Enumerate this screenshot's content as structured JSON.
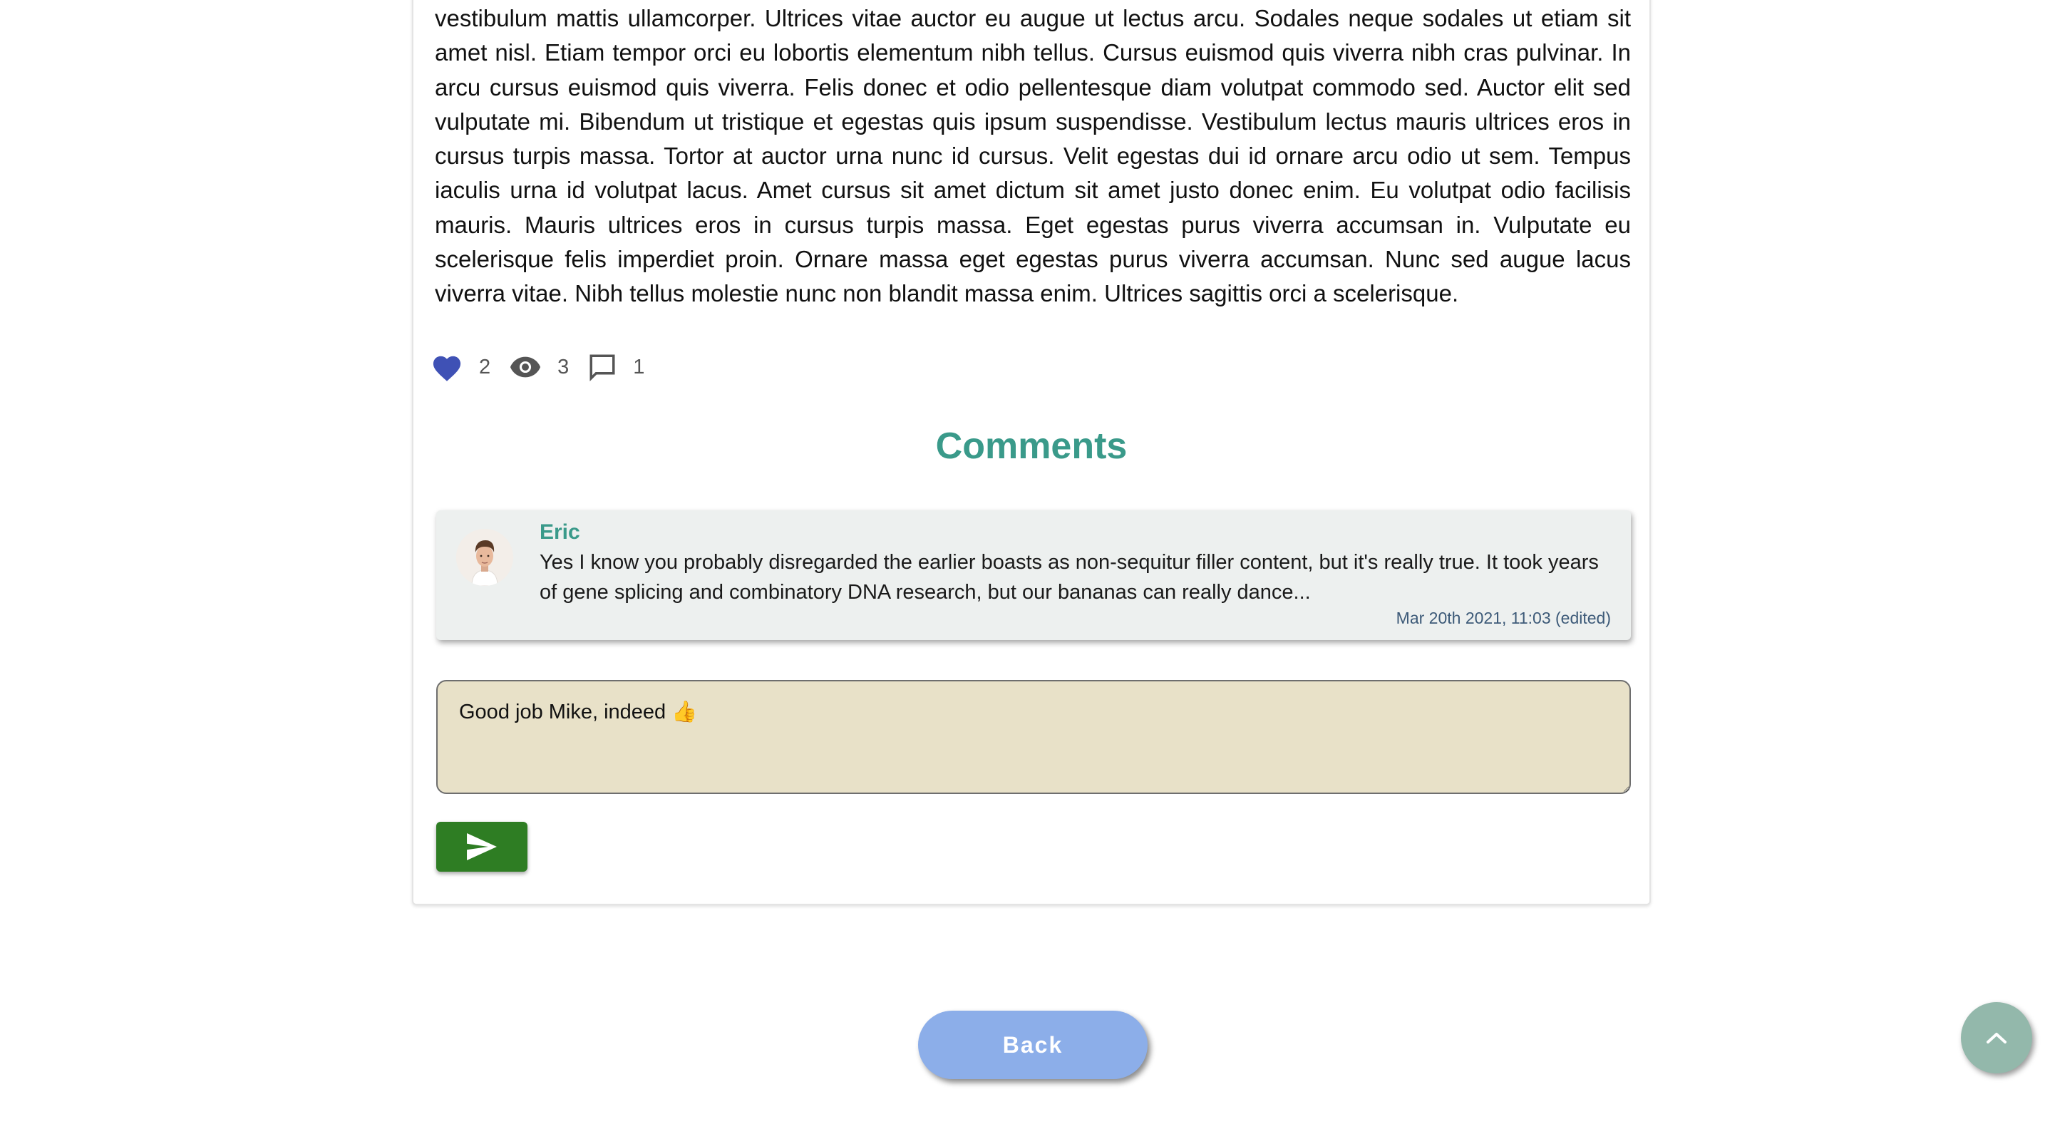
{
  "article": {
    "body": "vestibulum mattis ullamcorper. Ultrices vitae auctor eu augue ut lectus arcu. Sodales neque sodales ut etiam sit amet nisl. Etiam tempor orci eu lobortis elementum nibh tellus. Cursus euismod quis viverra nibh cras pulvinar. In arcu cursus euismod quis viverra. Felis donec et odio pellentesque diam volutpat commodo sed. Auctor elit sed vulputate mi. Bibendum ut tristique et egestas quis ipsum suspendisse. Vestibulum lectus mauris ultrices eros in cursus turpis massa. Tortor at auctor urna nunc id cursus. Velit egestas dui id ornare arcu odio ut sem. Tempus iaculis urna id volutpat lacus. Amet cursus sit amet dictum sit amet justo donec enim. Eu volutpat odio facilisis mauris. Mauris ultrices eros in cursus turpis massa. Eget egestas purus viverra accumsan in. Vulputate eu scelerisque felis imperdiet proin. Ornare massa eget egestas purus viverra accumsan. Nunc sed augue lacus viverra vitae. Nibh tellus molestie nunc non blandit massa enim. Ultrices sagittis orci a scelerisque."
  },
  "stats": {
    "likes": "2",
    "views": "3",
    "comments": "1",
    "icons": [
      "heart-icon",
      "eye-icon",
      "comment-icon"
    ]
  },
  "comments_section": {
    "title": "Comments",
    "items": [
      {
        "author": "Eric",
        "text": "Yes I know you probably disregarded the earlier boasts as non-sequitur filler content, but it's really true. It took years of gene splicing and combinatory DNA research, but our bananas can really dance...",
        "date": "Mar 20th 2021, 11:03 (edited)"
      }
    ],
    "input_value": "Good job Mike, indeed 👍",
    "send_icon": "send-icon"
  },
  "back_label": "Back",
  "scroll_top_icon": "chevron-up-icon",
  "colors": {
    "accent": "#3a9a8a",
    "like": "#3f51b5",
    "send_button": "#2e7d23",
    "back_button": "#8caee9",
    "comment_input_bg": "#e8e1c8",
    "scroll_top": "#93b8ab"
  }
}
